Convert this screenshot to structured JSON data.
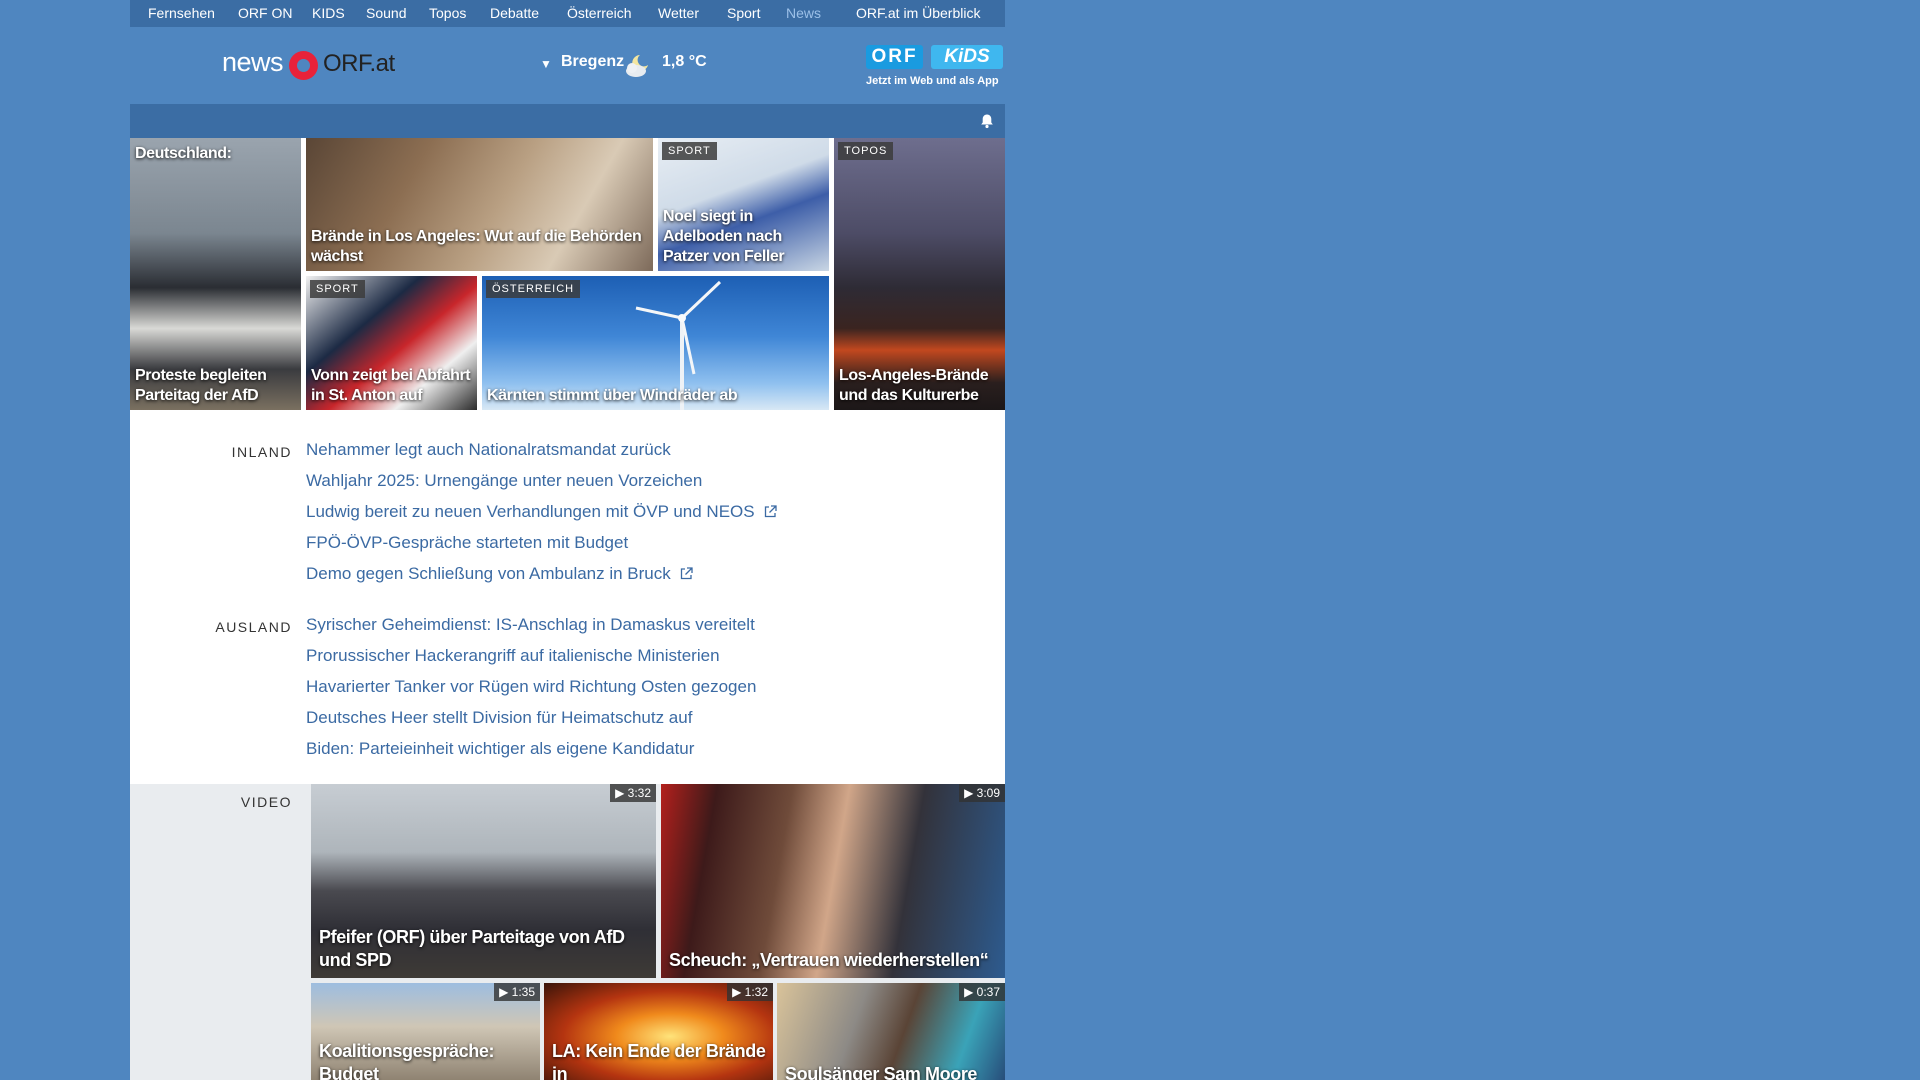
{
  "topnav": {
    "items": [
      "Fernsehen",
      "ORF ON",
      "KIDS",
      "Sound",
      "Topos",
      "Debatte",
      "Österreich",
      "Wetter",
      "Sport",
      "News"
    ],
    "overview": "ORF.at im Überblick"
  },
  "header": {
    "logo_news": "news",
    "logo_orf": "ORF.at",
    "weather": {
      "city": "Bregenz",
      "temp": "1,8 °C"
    },
    "kids_promo": {
      "orf": "ORF",
      "kids": "KiDS",
      "tagline": "Jetzt im Web und als App"
    }
  },
  "tiles": [
    {
      "caption": "Deutschland:",
      "caption2": "Proteste begleiten Parteitag der AfD",
      "badge": ""
    },
    {
      "caption": "Brände in Los Angeles: Wut auf die Behörden wächst",
      "badge": ""
    },
    {
      "caption": "Noel siegt in Adelboden nach Patzer von Feller",
      "badge": "SPORT"
    },
    {
      "caption": "Los-Angeles-Brände und das Kulturerbe",
      "badge": "TOPOS"
    },
    {
      "caption": "Vonn zeigt bei Abfahrt in St. Anton auf",
      "badge": "SPORT"
    },
    {
      "caption": "Kärnten stimmt über Windräder ab",
      "badge": "ÖSTERREICH"
    }
  ],
  "inland": {
    "label": "INLAND",
    "headlines": [
      "Nehammer legt auch Nationalratsmandat zurück",
      "Wahljahr 2025: Urnengänge unter neuen Vorzeichen",
      "Ludwig bereit zu neuen Verhandlungen mit ÖVP und NEOS",
      "FPÖ-ÖVP-Gespräche starteten mit Budget",
      "Demo gegen Schließung von Ambulanz in Bruck"
    ]
  },
  "ausland": {
    "label": "AUSLAND",
    "headlines": [
      "Syrischer Geheimdienst: IS-Anschlag in Damaskus vereitelt",
      "Prorussischer Hackerangriff auf italienische Ministerien",
      "Havarierter Tanker vor Rügen wird Richtung Osten gezogen",
      "Deutsches Heer stellt Division für Heimatschutz auf",
      "Biden: Parteieinheit wichtiger als eigene Kandidatur"
    ]
  },
  "video": {
    "label": "VIDEO",
    "items": [
      {
        "caption": "Pfeifer (ORF) über Parteitage von AfD und SPD",
        "duration": "▶ 3:32"
      },
      {
        "caption": "Scheuch: „Vertrauen wiederherstellen“",
        "duration": "▶ 3:09"
      },
      {
        "caption": "Koalitionsgespräche: Budget",
        "duration": "▶ 1:35"
      },
      {
        "caption": "LA: Kein Ende der Brände in",
        "duration": "▶ 1:32"
      },
      {
        "caption": "Soulsänger Sam Moore",
        "duration": "▶ 0:37"
      }
    ]
  }
}
